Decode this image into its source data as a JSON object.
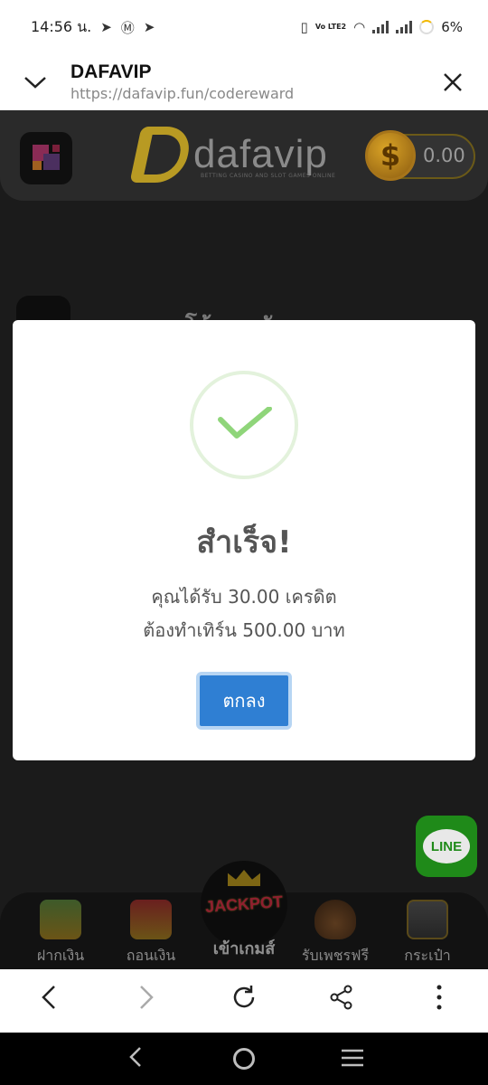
{
  "status_bar": {
    "time": "14:56 น.",
    "volte": "Vo LTE2",
    "battery": "6%"
  },
  "browser_header": {
    "site_name": "DAFAVIP",
    "url": "https://dafavip.fun/codereward"
  },
  "page": {
    "logo_word": "dafavip",
    "logo_tagline": "BETTING CASINO AND SLOT GAMES ONLINE",
    "balance": "0.00",
    "section_title": "โค้ดรางวัล",
    "line_label": "LINE",
    "bottom_nav": {
      "deposit": "ฝากเงิน",
      "withdraw": "ถอนเงิน",
      "jackpot_badge": "JACKPOT",
      "enter_game": "เข้าเกมส์",
      "free_diamond": "รับเพชรฟรี",
      "wallet": "กระเป๋า"
    }
  },
  "modal": {
    "title": "สำเร็จ!",
    "line1": "คุณได้รับ 30.00 เครดิต",
    "line2": "ต้องทำเทิร์น 500.00 บาท",
    "ok_label": "ตกลง"
  },
  "colors": {
    "ok_button": "#2f7fd3",
    "check_green": "#8fd57a",
    "line_green": "#1f8a19"
  }
}
